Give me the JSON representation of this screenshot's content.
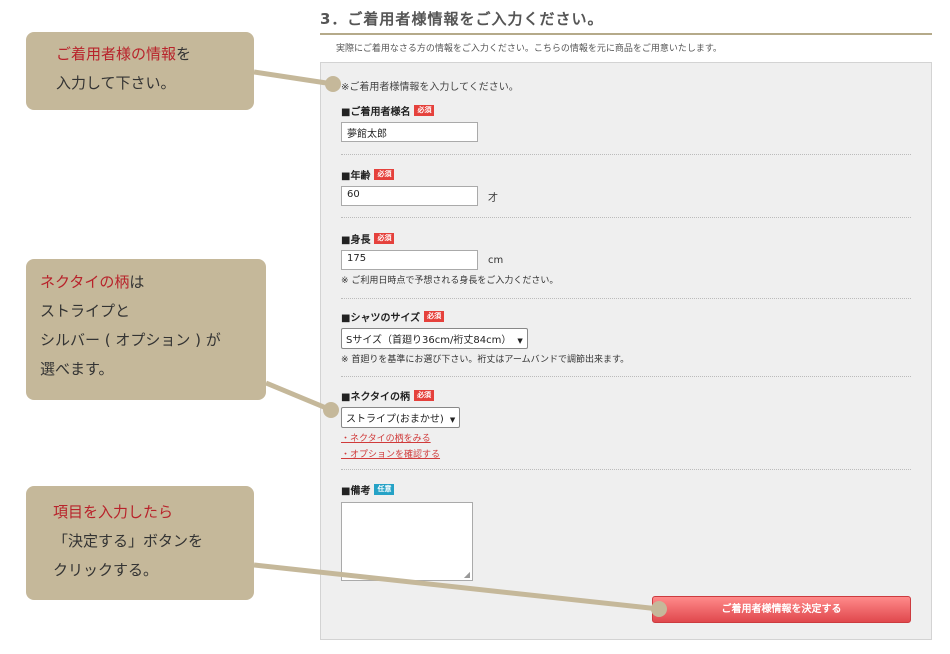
{
  "section": {
    "title": "3．ご着用者様情報をご入力ください。",
    "subtitle": "実際にご着用なさる方の情報をご入力ください。こちらの情報を元に商品をご用意いたします。"
  },
  "form": {
    "intro": "※ご着用者様情報を入力してください。",
    "badges": {
      "required": "必須",
      "optional": "任意"
    },
    "name": {
      "label": "■ご着用者様名",
      "value": "夢館太郎"
    },
    "age": {
      "label": "■年齢",
      "value": "60",
      "unit": "才"
    },
    "height": {
      "label": "■身長",
      "value": "175",
      "unit": "cm",
      "note": "※ ご利用日時点で予想される身長をご入力ください。"
    },
    "shirt_size": {
      "label": "■シャツのサイズ",
      "selected": "Sサイズ（首廻り36cm/裄丈84cm）",
      "note": "※ 首廻りを基準にお選び下さい。裄丈はアームバンドで調節出来ます。"
    },
    "tie_pattern": {
      "label": "■ネクタイの柄",
      "selected": "ストライプ(おまかせ)",
      "links": [
        "・ネクタイの柄をみる",
        "・オプションを確認する"
      ]
    },
    "remarks": {
      "label": "■備考",
      "value": ""
    },
    "submit_label": "ご着用者様情報を決定する"
  },
  "callouts": [
    {
      "lines": [
        {
          "red": "ご着用者様の情報",
          "normal": "を"
        },
        {
          "red": "",
          "normal": "入力して下さい。"
        }
      ]
    },
    {
      "lines": [
        {
          "red": "ネクタイの柄",
          "normal": "は"
        },
        {
          "red": "",
          "normal": "ストライプと"
        },
        {
          "red": "",
          "normal": "シルバー ( オプション ) が"
        },
        {
          "red": "",
          "normal": "選べます。"
        }
      ]
    },
    {
      "lines": [
        {
          "red": "項目を入力したら",
          "normal": ""
        },
        {
          "red": "",
          "normal": "「決定する」ボタンを"
        },
        {
          "red": "",
          "normal": "クリックする。"
        }
      ]
    }
  ],
  "colors": {
    "callout_bg": "#c5b89a",
    "accent_red": "#e5413c",
    "link_red": "#d03b3b",
    "optional_blue": "#25a2c6"
  }
}
